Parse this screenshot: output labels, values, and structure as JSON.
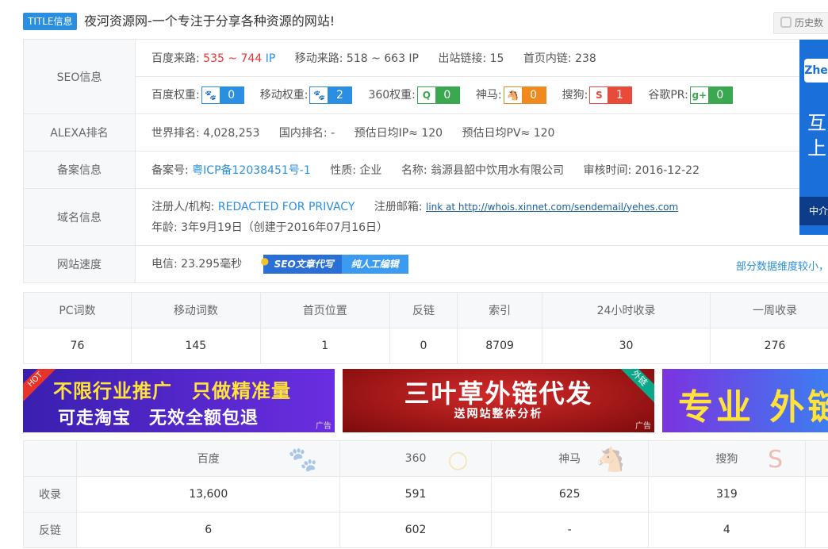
{
  "header": {
    "tag": "TITLE信息",
    "title": "夜河资源网-一个专注于分享各种资源的网站!",
    "history": "历史数"
  },
  "seo": {
    "label": "SEO信息",
    "baidu_source_label": "百度来路:",
    "baidu_source_value": "535 ~ 744",
    "baidu_source_unit": "IP",
    "mobile_source_label": "移动来路:",
    "mobile_source_value": "518 ~ 663 IP",
    "outlinks_label": "出站链接:",
    "outlinks_value": "15",
    "inlinks_label": "首页内链:",
    "inlinks_value": "238",
    "weights": [
      {
        "label": "百度权重:",
        "value": "0",
        "icon": "🐾",
        "color": "blue",
        "name": "baidu"
      },
      {
        "label": "移动权重:",
        "value": "2",
        "icon": "🐾",
        "color": "blue",
        "name": "mobile"
      },
      {
        "label": "360权重:",
        "value": "0",
        "icon": "Q",
        "color": "green",
        "name": "360"
      },
      {
        "label": "神马:",
        "value": "0",
        "icon": "🐴",
        "color": "orange",
        "name": "shenma"
      },
      {
        "label": "搜狗:",
        "value": "1",
        "icon": "S",
        "color": "red",
        "name": "sogou"
      },
      {
        "label": "谷歌PR:",
        "value": "0",
        "icon": "g+",
        "color": "green",
        "name": "google"
      }
    ]
  },
  "alexa": {
    "label": "ALEXA排名",
    "world_label": "世界排名:",
    "world_value": "4,028,253",
    "domestic_label": "国内排名:",
    "domestic_value": "-",
    "ip_label": "预估日均IP≈",
    "ip_value": "120",
    "pv_label": "预估日均PV≈",
    "pv_value": "120"
  },
  "icp": {
    "label": "备案信息",
    "no_label": "备案号:",
    "no_value": "粤ICP备12038451号-1",
    "type_label": "性质:",
    "type_value": "企业",
    "name_label": "名称:",
    "name_value": "翁源县韶中饮用水有限公司",
    "date_label": "审核时间:",
    "date_value": "2016-12-22"
  },
  "domain": {
    "label": "域名信息",
    "registrant_label": "注册人/机构:",
    "registrant_value": "REDACTED FOR PRIVACY",
    "email_label": "注册邮箱:",
    "email_value": "link at http://whois.xinnet.com/sendemail/yehes.com",
    "age_label": "年龄:",
    "age_value": "3年9月19日（创建于2016年07月16日）"
  },
  "speed": {
    "label": "网站速度",
    "telecom_label": "电信:",
    "telecom_value": "23.295毫秒",
    "promo_1": "SEO文章代写",
    "promo_2": "纯人工编辑",
    "note": "部分数据维度较小，无"
  },
  "side_ad": {
    "logo": "Zhe",
    "big_1": "互",
    "big_2": "上",
    "foot": "中介"
  },
  "stats": {
    "headers": [
      "PC词数",
      "移动词数",
      "首页位置",
      "反链",
      "索引",
      "24小时收录",
      "一周收录"
    ],
    "values": [
      "76",
      "145",
      "1",
      "0",
      "8709",
      "30",
      "276"
    ]
  },
  "banners": {
    "b1_l1": "不限行业推广　只做精准量",
    "b1_l2": "可走淘宝　无效全额包退",
    "b1_hot": "HOT",
    "b1_ad": "广告",
    "b2_l1": "三叶草外链代发",
    "b2_l2": "送网站整体分析",
    "b2_corner": "外链",
    "b2_ad": "广告",
    "b3_l1": "专业 外链"
  },
  "engines": {
    "headers": [
      "百度",
      "360",
      "神马",
      "搜狗"
    ],
    "row_index": {
      "label": "收录",
      "values": [
        "13,600",
        "591",
        "625",
        "319"
      ]
    },
    "row_backlink": {
      "label": "反链",
      "values": [
        "6",
        "602",
        "-",
        "4"
      ]
    }
  }
}
